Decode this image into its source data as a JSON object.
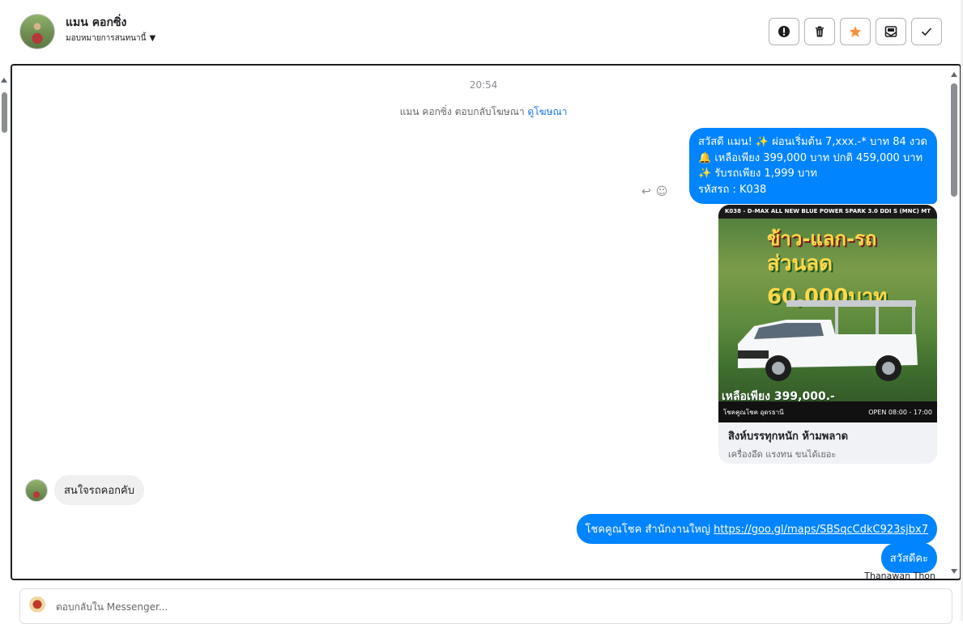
{
  "header": {
    "contact_name": "แมน คอกซิ่ง",
    "assign_label": "มอบหมายการสนทนานี้",
    "actions": [
      "alert-icon",
      "trash-icon",
      "star-icon",
      "mark-unread-icon",
      "check-icon"
    ],
    "star_color": "#f7923a"
  },
  "chat": {
    "timestamp": "20:54",
    "ad_reply_text": "แมน คอกซิ่ง ตอบกลับโฆษณา",
    "ad_link": "ดูโฆษณา",
    "messages": {
      "welcome_lines": [
        "สวัสดี แมน! ✨ ผ่อนเริ่มต้น 7,xxx.-* บาท 84 งวด",
        "🔔 เหลือเพียง 399,000 บาท ปกติ 459,000 บาท",
        "✨ รับรถเพียง 1,999 บาท",
        "รหัสรถ : K038"
      ],
      "card": {
        "image_topbar": "K038 - D-MAX ALL NEW BLUE POWER SPARK 3.0 DDI S (MNC) MT",
        "image_headline_1": "ข้าว-แลก-รถ",
        "image_headline_2": "ส่วนลด 60,000บาท",
        "image_price": "เหลือเพียง 399,000.-",
        "image_brand": "โชคคูณโชค อุดรธานี",
        "image_open": "OPEN 08:00 - 17:00",
        "title": "สิงห์บรรทุกหนัก ห้ามพลาด",
        "subtitle": "เครื่องอึด แรงทน ขนได้เยอะ"
      },
      "incoming": "สนใจรถคอกคับ",
      "location_prefix": "โชคคูณโชค สำนักงานใหญ่",
      "location_url": "https://goo.gl/maps/SBSqcCdkC923sjbx7",
      "greeting": "สวัสดีคะ",
      "sender_name": "Thanawan Thon"
    },
    "bubble_color": "#0084ff"
  },
  "reply": {
    "placeholder": "ตอบกลับใน Messenger..."
  }
}
